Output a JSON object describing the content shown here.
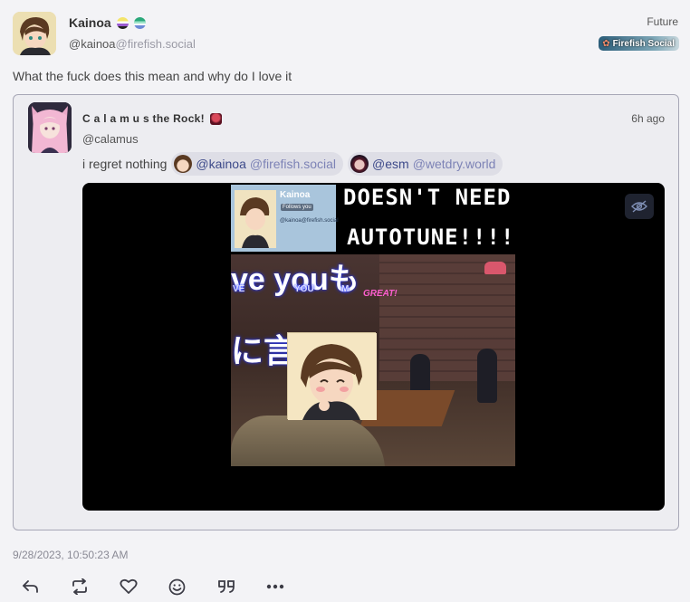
{
  "note": {
    "author": {
      "name": "Kainoa",
      "handle_user": "@kainoa",
      "handle_host": "@firefish.social"
    },
    "visibility": "Future",
    "instance": {
      "name": "Firefish Social",
      "icon": "fish-icon",
      "color": "#2b5d79"
    },
    "text": "What the fuck does this mean and why do I love it",
    "timestamp": "9/28/2023, 10:50:23 AM"
  },
  "quote": {
    "author": {
      "name": "C a l a m u s the Rock!",
      "handle": "@calamus"
    },
    "time": "6h ago",
    "text": "i regret nothing",
    "mentions": [
      {
        "user": "@kainoa",
        "host": "@firefish.social"
      },
      {
        "user": "@esm",
        "host": "@wetdry.world"
      }
    ],
    "media": {
      "sensitive_toggle_icon": "eye-slash-icon",
      "card_name": "Kainoa",
      "card_follow": "Follows you",
      "card_handle": "@kainoa@firefish.social",
      "caption_line1": "DOESN'T NEED",
      "caption_line2": "AUTOTUNE!!!!",
      "lyric_line1": "ve  youも",
      "lyric_sub_1": "VE",
      "lyric_sub_2": "YOU",
      "lyric_sub_3": "M",
      "lyric_great": "GREAT!",
      "lyric_line2": "に言わい"
    }
  },
  "actions": [
    {
      "name": "reply",
      "icon": "reply-icon",
      "glyph": "↶"
    },
    {
      "name": "boost",
      "icon": "repeat-icon",
      "glyph": "⇄"
    },
    {
      "name": "like",
      "icon": "heart-icon",
      "glyph": "♡"
    },
    {
      "name": "react",
      "icon": "smiley-icon",
      "glyph": "☺"
    },
    {
      "name": "quote",
      "icon": "quote-icon",
      "glyph": "”"
    },
    {
      "name": "more",
      "icon": "more-icon",
      "glyph": "•••"
    }
  ]
}
